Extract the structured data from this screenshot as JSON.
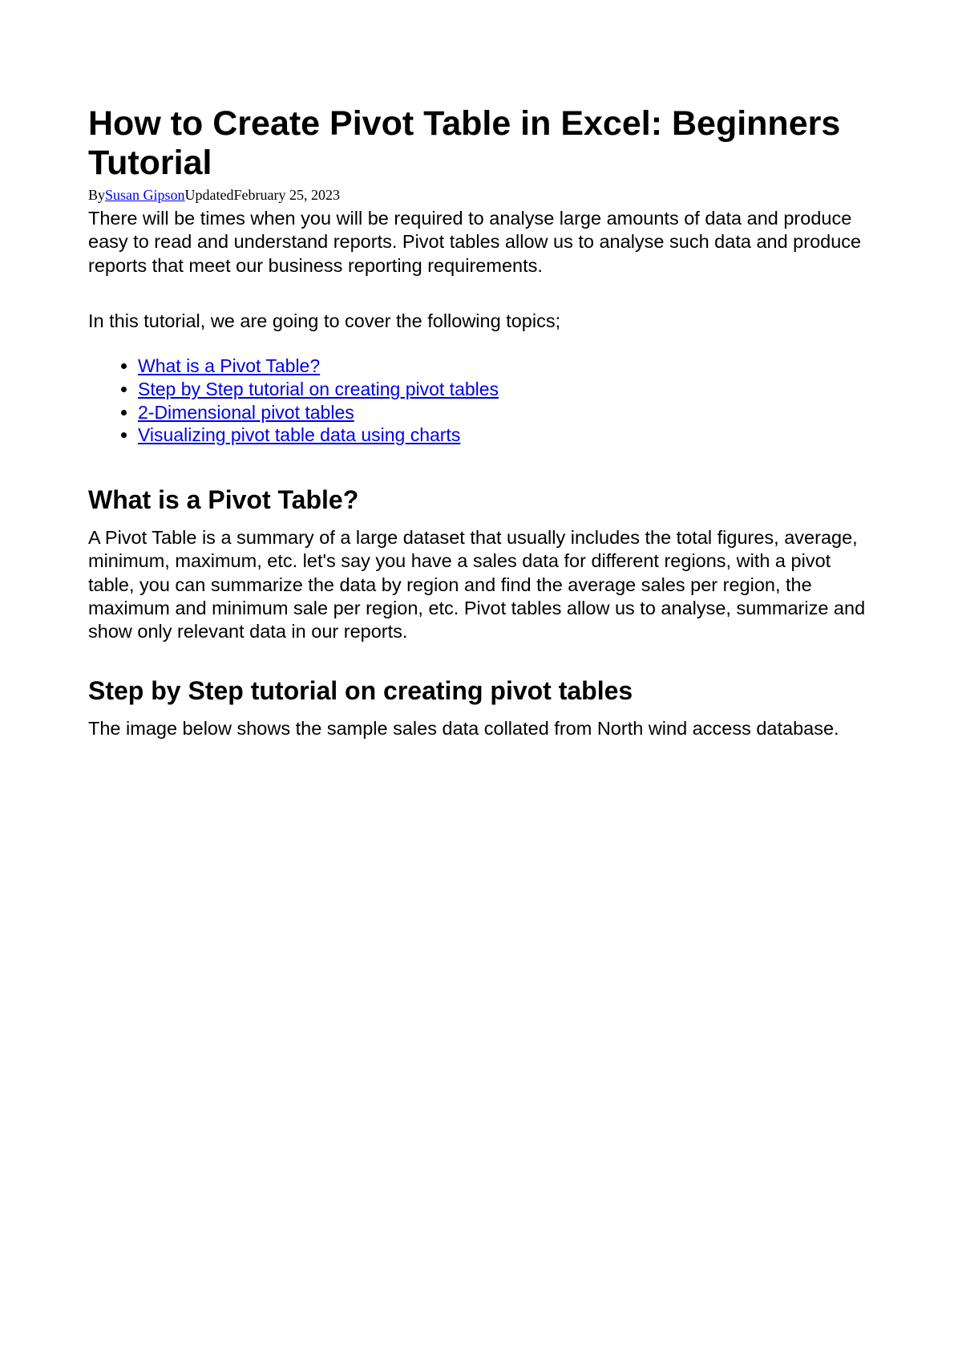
{
  "title": "How to Create Pivot Table in Excel: Beginners Tutorial",
  "byline": {
    "by_label": "By",
    "author": "Susan Gipson",
    "updated_label": "Updated",
    "date": "February 25, 2023"
  },
  "intro": "There will be times when you will be required to analyse large amounts of data and produce easy to read and understand reports. Pivot tables allow us to analyse such data and produce reports that meet our business reporting requirements.",
  "topics_intro": "In this tutorial, we are going to cover the following topics;",
  "toc": [
    "What is a Pivot Table?",
    "Step by Step tutorial on creating pivot tables",
    "2-Dimensional pivot tables",
    "Visualizing pivot table data using charts"
  ],
  "sections": {
    "what_is": {
      "heading": "What is a Pivot Table?",
      "body": "A Pivot Table is a summary of a large dataset that usually includes the total figures, average, minimum, maximum, etc. let's say you have a sales data for different regions, with a pivot table, you can summarize the data by region and find the average sales per region, the maximum and minimum sale per region, etc. Pivot tables allow us to analyse, summarize and show only relevant data in our reports."
    },
    "step_by_step": {
      "heading": "Step by Step tutorial on creating pivot tables",
      "body": "The image below shows the sample sales data collated from North wind access database."
    }
  }
}
